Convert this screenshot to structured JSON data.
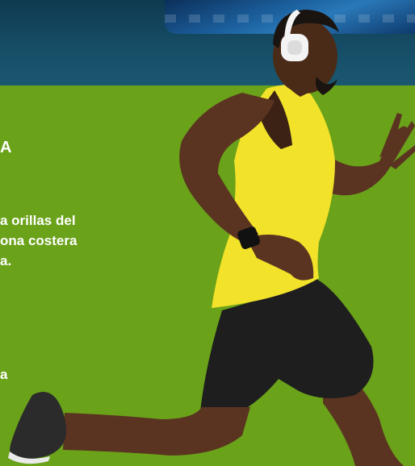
{
  "headline_fragment": "A",
  "paragraph": {
    "line1": "a orillas del",
    "line2": "ona costera",
    "line3": "a."
  },
  "bottom_fragment": "a",
  "colors": {
    "panel_green": "#6aa21a",
    "top_band": "#164d66",
    "shirt_yellow": "#f2e22a",
    "shorts_black": "#1e1e1e",
    "text": "#ffffff"
  }
}
